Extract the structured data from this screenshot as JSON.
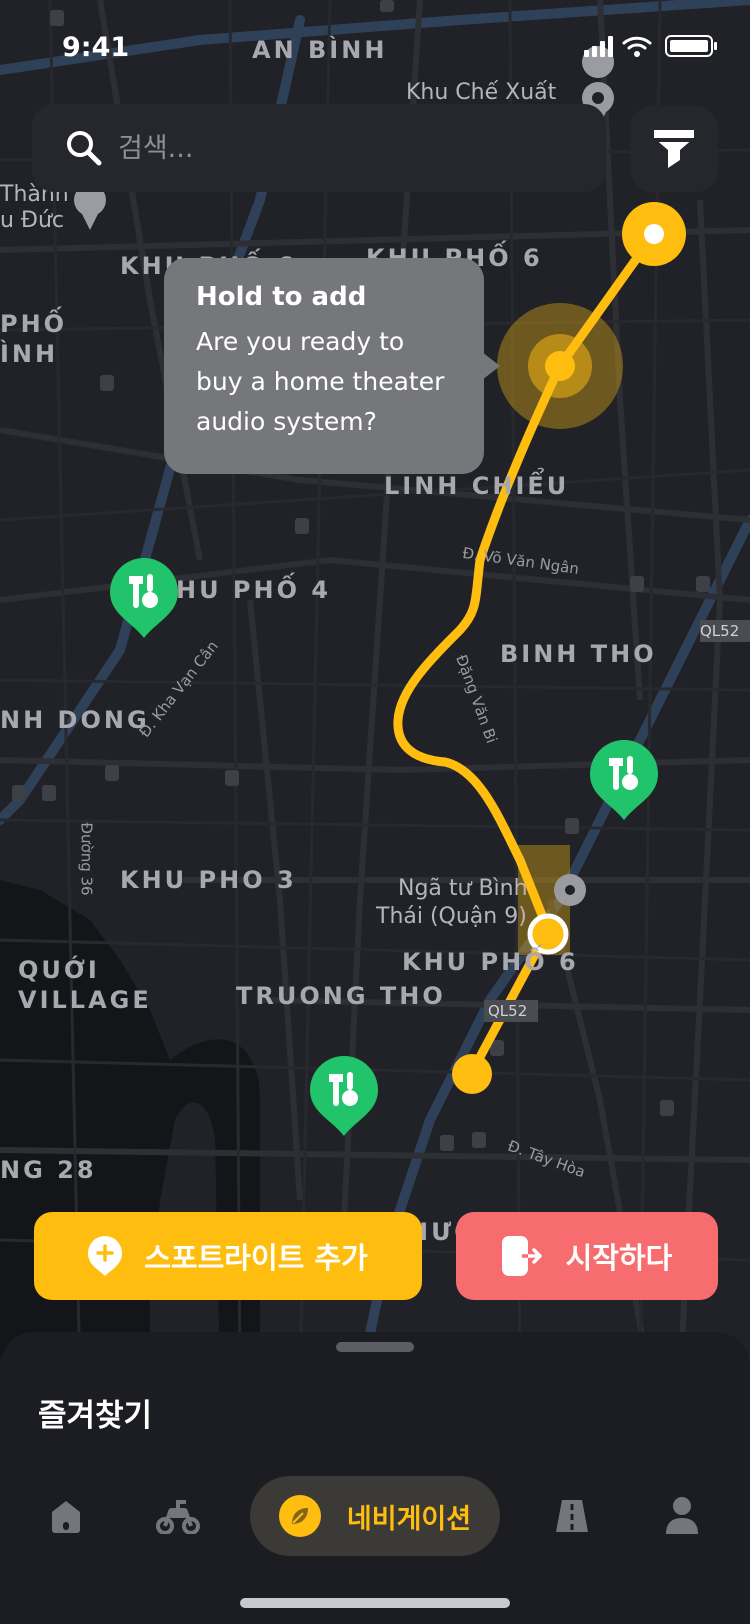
{
  "status_bar": {
    "time": "9:41"
  },
  "search": {
    "placeholder": "검색..."
  },
  "tooltip": {
    "title": "Hold to add",
    "body": "Are you ready to buy a home theater audio system?"
  },
  "map_labels": {
    "an_binh": "AN BÌNH",
    "khu_che_xuat": "Khu Chế Xuất",
    "thanh": "Thành",
    "u_duc": "u Đức",
    "khu_pho_6_top": "KHU PHỐ 6",
    "khu_pho_left": "KHU PHỐ 6",
    "pho": "PHỐ",
    "inh": "ÌNH",
    "linh_chieu": "LINH CHIỂU",
    "do_van_ngan": "Đ. Võ Văn Ngân",
    "khu_pho_4": "HU PHỐ 4",
    "binh_tho": "BINH THO",
    "ql52_right": "QL52",
    "nh_dong": "NH DONG",
    "kha_van_can": "Đ. Kha Vạn Cân",
    "dang_van_bi": "Đặng Văn Bi",
    "duong_36": "Đường 36",
    "khu_pho_3": "KHU PHO 3",
    "nga_tu": "Ngã tư Bình",
    "thai_quan": "Thái (Quận 9)",
    "khu_pho_6_bottom": "KHU PHỐ 6",
    "quoi": "QUỚI",
    "village": "VILLAGE",
    "truong_tho": "TRUONG THO",
    "ql52_bottom": "QL52",
    "ng_28": "NG 28",
    "tay_hoa": "Đ. Tây Hòa",
    "huo": "HƯỚ"
  },
  "buttons": {
    "spotlight": "스포트라이트 추가",
    "start": "시작하다"
  },
  "sheet": {
    "title": "즐겨찾기"
  },
  "tabs": {
    "active_label": "네비게이션"
  },
  "colors": {
    "accent": "#FFBD10",
    "start": "#F76C6E",
    "pin": "#21C36B",
    "map_bg": "#202227"
  },
  "icons": [
    "search-icon",
    "filter-icon",
    "tools-pin-icon",
    "add-location-icon",
    "exit-icon",
    "home-icon",
    "scooter-icon",
    "compass-leaf-icon",
    "road-icon",
    "user-icon"
  ]
}
